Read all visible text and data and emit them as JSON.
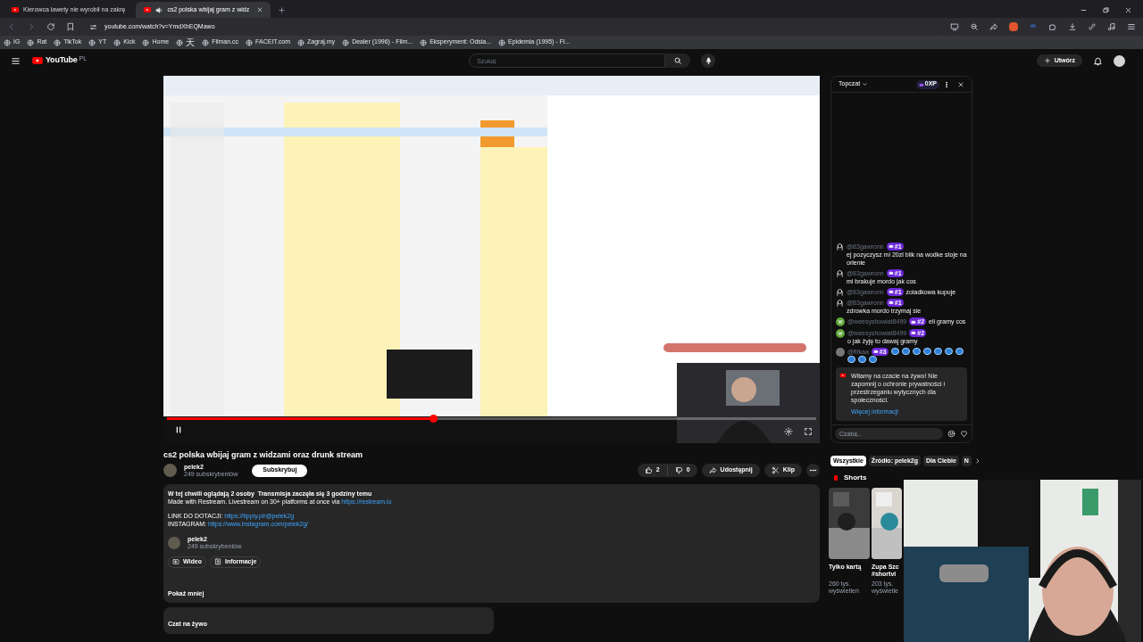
{
  "browser": {
    "tabs": [
      {
        "title": "Kierowca lawety nie wyrobił na zakrę",
        "selected": false,
        "audio": false
      },
      {
        "title": "cs2 polska wbijaj gram z widz",
        "selected": true,
        "audio": true
      }
    ],
    "url": "youtube.com/watch?v=YmdXhEQMawo",
    "bookmarks": [
      "IG",
      "Rat",
      "TikTok",
      "YT",
      "Kick",
      "Home",
      "天",
      "Filman.cc",
      "FACEIT.com",
      "Zagraj.my",
      "Dealer (1996) - Film...",
      "Eksperyment: Odsia...",
      "Epidemia (1995) - Fi..."
    ]
  },
  "header": {
    "logo": "YouTube",
    "region": "PL",
    "search_placeholder": "Szukaj",
    "create": "Utwórz"
  },
  "player": {
    "progress": {
      "level": 0.41
    }
  },
  "chat": {
    "title": "Topczat",
    "xp": "0XP",
    "messages": [
      {
        "author": "@83gawronn",
        "rank": "#1",
        "text": "ej pozyczysz mi 20zl blik na wodke stoje na orlenie",
        "kind": "text",
        "avatar": {
          "kind": "outline"
        }
      },
      {
        "author": "@83gawronn",
        "rank": "#1",
        "text": "mi brakuje mordo jak cos",
        "kind": "text",
        "avatar": {
          "kind": "outline"
        }
      },
      {
        "author": "@83gawronn",
        "rank": "#1",
        "text": "zoladkowa kupuje",
        "kind": "text",
        "avatar": {
          "kind": "outline"
        }
      },
      {
        "author": "@83gawronn",
        "rank": "#1",
        "text": "zdrowka mordo trzymaj sie",
        "kind": "text",
        "avatar": {
          "kind": "outline"
        }
      },
      {
        "author": "@weesyshowiat8499",
        "rank": "#2",
        "text": "eli gramy cos",
        "kind": "text",
        "avatar": {
          "kind": "letter",
          "initial": "w"
        }
      },
      {
        "author": "@weesyshowiat8499",
        "rank": "#2",
        "text": "o jak żyję to dawaj gramy",
        "kind": "text",
        "avatar": {
          "kind": "letter",
          "initial": "w"
        }
      },
      {
        "author": "@fifkaa",
        "rank": "#3",
        "kind": "emotes",
        "emotes": [
          {
            "kind": "blob"
          },
          {
            "kind": "blob"
          },
          {
            "kind": "blob"
          },
          {
            "kind": "blob"
          },
          {
            "kind": "blob"
          },
          {
            "kind": "blob"
          },
          {
            "kind": "blob"
          },
          {
            "kind": "blob"
          },
          {
            "kind": "blob"
          },
          {
            "kind": "blob"
          }
        ]
      }
    ],
    "notice": {
      "text": "Witamy na czacie na żywo! Nie zapomnij o ochronie prywatności i przestrzeganiu wytycznych dla społeczności.",
      "link": "Więcej informacji"
    },
    "input_placeholder": "Czatuj..."
  },
  "video": {
    "title": "cs2 polska wbijaj gram z widzami oraz drunk stream",
    "channel": "pelek2",
    "subscribers": "249 subskrybentów",
    "subscribe": "Subskrybuj",
    "likes": "2",
    "dislikes": "0",
    "share": "Udostępnij",
    "clip": "Klip"
  },
  "description": {
    "paragraphs": [
      [
        {
          "parts": [
            {
              "text": "W tej chwili oglądają 2 osoby  Transmisja zaczęła się 3 godziny temu",
              "kind": "bold"
            }
          ]
        },
        {
          "parts": [
            {
              "text": "Made with Restream. Livestream on 30+ platforms at once via ",
              "kind": "plain"
            },
            {
              "text": "https://restream.io",
              "kind": "link"
            }
          ]
        }
      ],
      [
        {
          "parts": [
            {
              "text": "LINK DO DOTACJI: ",
              "kind": "plain"
            },
            {
              "text": "https://tipply.pl/@pelek2g",
              "kind": "link"
            }
          ]
        },
        {
          "parts": [
            {
              "text": "INSTAGRAM: ",
              "kind": "plain"
            },
            {
              "text": "https://www.instagram.com/pelek2g/",
              "kind": "link"
            }
          ]
        }
      ]
    ],
    "channel": "pelek2",
    "subscribers": "249 subskrybentów",
    "buttons": [
      {
        "label": "Wideo",
        "kind": "video"
      },
      {
        "label": "Informacje",
        "kind": "info"
      }
    ],
    "less": "Pokaż mniej"
  },
  "live_chat": {
    "title": "Czat na żywo"
  },
  "chips": [
    {
      "label": "Wszystkie",
      "selected": true
    },
    {
      "label": "Źródło: pelek2g",
      "selected": false
    },
    {
      "label": "Dla Ciebie",
      "selected": false
    },
    {
      "label": "N",
      "selected": false
    }
  ],
  "shorts": {
    "title": "Shorts",
    "items": [
      {
        "title": "Tylko kartą",
        "views": "260 tys.",
        "unit": "wyświetleń"
      },
      {
        "title": "Zupa Szc",
        "tag": "#shortvi",
        "views": "203 tys.",
        "unit": "wyświetle"
      }
    ]
  }
}
